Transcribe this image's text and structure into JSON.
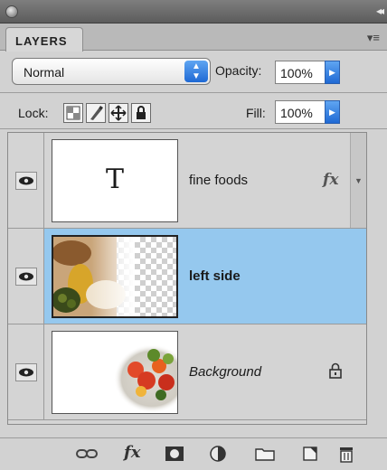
{
  "panel": {
    "tab_label": "LAYERS"
  },
  "blend": {
    "mode": "Normal",
    "opacity_label": "Opacity:",
    "opacity": "100%"
  },
  "lock": {
    "label": "Lock:",
    "fill_label": "Fill:",
    "fill": "100%"
  },
  "layers": [
    {
      "name": "fine foods",
      "thumb_text": "T",
      "visible": true,
      "selected": false,
      "badge": "fx"
    },
    {
      "name": "left side",
      "visible": true,
      "selected": true
    },
    {
      "name": "Background",
      "visible": true,
      "selected": false,
      "italic": true,
      "locked": true
    }
  ],
  "toolbar_icons": [
    "link-icon",
    "fx-icon",
    "mask-icon",
    "adjustment-icon",
    "folder-icon",
    "new-layer-icon",
    "trash-icon"
  ],
  "toolbar": {
    "fx_label": "fx"
  },
  "colors": {
    "selection": "#95c8ee",
    "accent_blue": "#1f69d4"
  }
}
